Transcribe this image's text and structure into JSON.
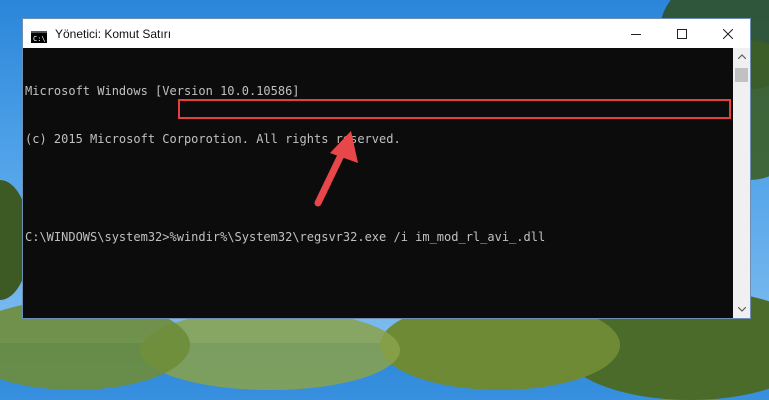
{
  "window": {
    "title": "Yönetici: Komut Satırı"
  },
  "console": {
    "lines": [
      "Microsoft Windows [Version 10.0.10586]",
      "(c) 2015 Microsoft Corporotion. All rights reserved.",
      "",
      ""
    ],
    "prompt": "C:\\WINDOWS\\system32>",
    "command": "%windir%\\System32\\regsvr32.exe /i im_mod_rl_avi_.dll"
  },
  "colors": {
    "highlight": "#e44040",
    "console_bg": "#0c0c0c",
    "console_text": "#c0c0c0"
  },
  "icons": {
    "window_icon": "cmd-icon",
    "minimize": "minimize-icon",
    "maximize": "maximize-icon",
    "close": "close-icon",
    "pointer": "red-arrow-icon"
  }
}
